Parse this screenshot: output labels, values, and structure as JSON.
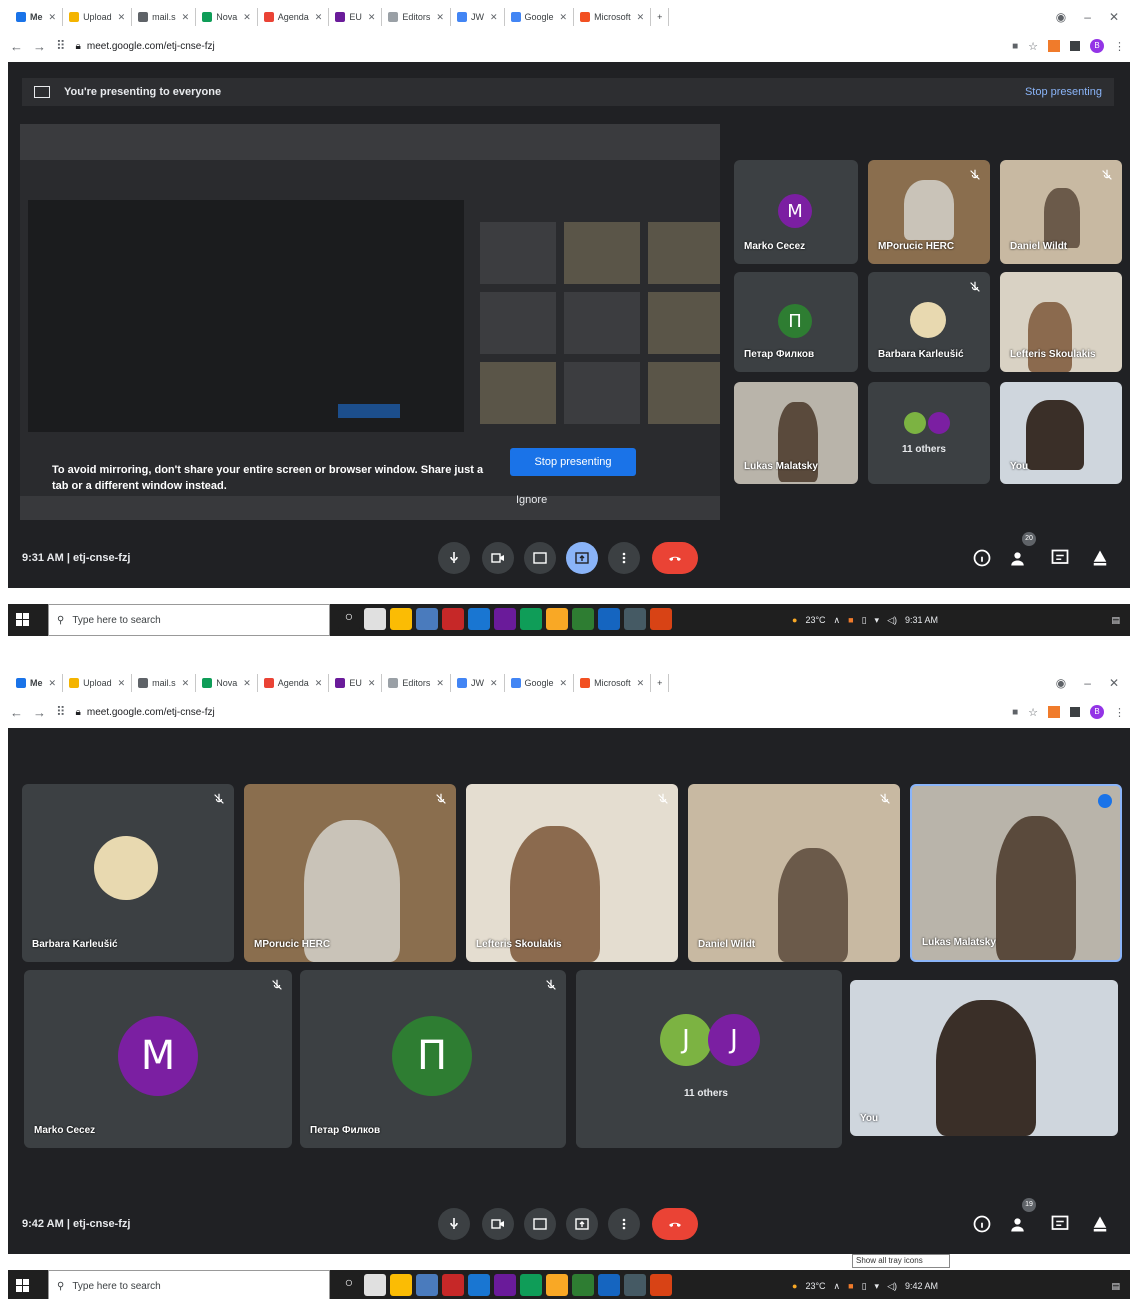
{
  "browser": {
    "tabs": [
      {
        "label": "Me",
        "color": "#1a73e8"
      },
      {
        "label": "Upload",
        "color": "#f4b400"
      },
      {
        "label": "mail.s",
        "color": "#5f6368"
      },
      {
        "label": "Nova",
        "color": "#0f9d58"
      },
      {
        "label": "Agenda",
        "color": "#ea4335"
      },
      {
        "label": "EU",
        "color": "#6a1b9a"
      },
      {
        "label": "Editors",
        "color": "#9aa0a6"
      },
      {
        "label": "JW",
        "color": "#4285f4"
      },
      {
        "label": "Google",
        "color": "#4285f4"
      },
      {
        "label": "Microsoft",
        "color": "#f25022"
      }
    ],
    "url": "meet.google.com/etj-cnse-fzj"
  },
  "shot1": {
    "banner_text": "You're presenting to everyone",
    "banner_stop": "Stop presenting",
    "mirror_warning": "To avoid mirroring, don't share your entire screen or browser window. Share just a tab or a different window instead.",
    "stop_button": "Stop presenting",
    "ignore_button": "Ignore",
    "participants": [
      {
        "name": "Marko Cecez",
        "initial": "M"
      },
      {
        "name": "MPorucic HERC"
      },
      {
        "name": "Daniel Wildt"
      },
      {
        "name": "Петар Филков",
        "initial": "П"
      },
      {
        "name": "Barbara Karleušić"
      },
      {
        "name": "Lefteris Skoulakis"
      },
      {
        "name": "Lukas Malatsky"
      },
      {
        "name": "11 others"
      },
      {
        "name": "You"
      }
    ],
    "time": "9:31 AM",
    "meeting_code": "etj-cnse-fzj",
    "people_count": "20"
  },
  "shot2": {
    "participants": [
      {
        "name": "Barbara Karleušić"
      },
      {
        "name": "MPorucic HERC"
      },
      {
        "name": "Lefteris Skoulakis"
      },
      {
        "name": "Daniel Wildt"
      },
      {
        "name": "Lukas Malatsky"
      },
      {
        "name": "Marko Cecez",
        "initial": "M"
      },
      {
        "name": "Петар Филков",
        "initial": "П"
      },
      {
        "name": "11 others",
        "initials": [
          "J",
          "J"
        ]
      },
      {
        "name": "You"
      }
    ],
    "time": "9:42 AM",
    "meeting_code": "etj-cnse-fzj",
    "people_count": "19",
    "tooltip": "Show all tray icons"
  },
  "taskbar": {
    "search_placeholder": "Type here to search",
    "weather": "23°C",
    "clock1": "9:31 AM",
    "clock2": "9:42 AM"
  },
  "colors": {
    "meet_bg": "#202124",
    "tile_bg": "#3c4043",
    "avatar_purple": "#7b1fa2",
    "avatar_green": "#2e7d32",
    "hangup": "#ea4335",
    "accent": "#1a73e8"
  }
}
